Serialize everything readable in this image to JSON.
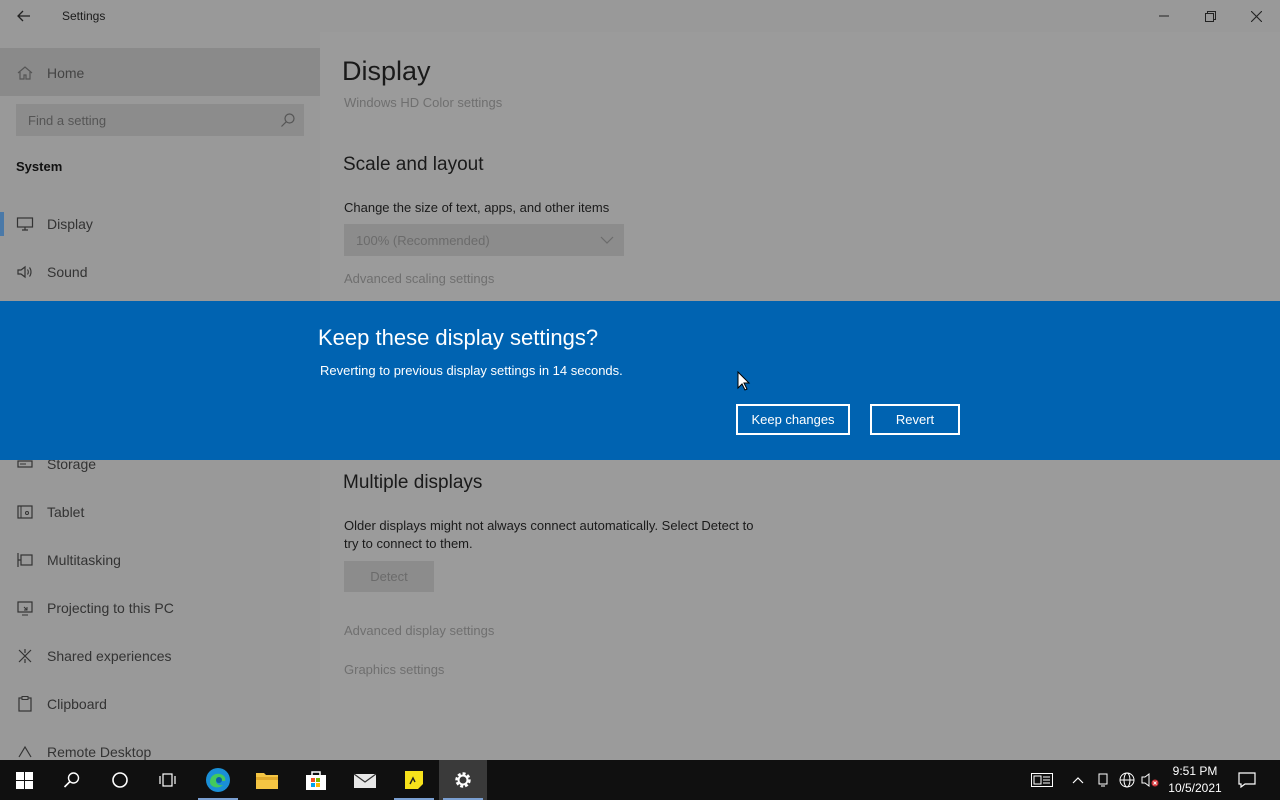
{
  "window": {
    "title": "Settings"
  },
  "sidebar": {
    "home_label": "Home",
    "search_placeholder": "Find a setting",
    "section_title": "System",
    "items": [
      {
        "label": "Display",
        "icon": "monitor-icon"
      },
      {
        "label": "Sound",
        "icon": "speaker-icon"
      },
      {
        "label": "Storage",
        "icon": "storage-icon"
      },
      {
        "label": "Tablet",
        "icon": "tablet-icon"
      },
      {
        "label": "Multitasking",
        "icon": "multitasking-icon"
      },
      {
        "label": "Projecting to this PC",
        "icon": "projecting-icon"
      },
      {
        "label": "Shared experiences",
        "icon": "shared-experiences-icon"
      },
      {
        "label": "Clipboard",
        "icon": "clipboard-icon"
      },
      {
        "label": "Remote Desktop",
        "icon": "remote-desktop-icon"
      }
    ]
  },
  "main": {
    "title": "Display",
    "header_link": "Windows HD Color settings",
    "scale_heading": "Scale and layout",
    "scale_label": "Change the size of text, apps, and other items",
    "scale_value": "100% (Recommended)",
    "advanced_scaling_link": "Advanced scaling settings",
    "multiple_heading": "Multiple displays",
    "multiple_text_1": "Older displays might not always connect automatically. Select Detect to",
    "multiple_text_2": "try to connect to them.",
    "detect_label": "Detect",
    "advanced_display_link": "Advanced display settings",
    "graphics_link": "Graphics settings"
  },
  "banner": {
    "title": "Keep these display settings?",
    "message": "Reverting to previous display settings in 14 seconds.",
    "keep_label": "Keep changes",
    "revert_label": "Revert"
  },
  "taskbar": {
    "time": "9:51 PM",
    "date": "10/5/2021"
  },
  "colors": {
    "banner": "#0063b1",
    "accent": "#4a79a8",
    "taskbar": "#101010"
  }
}
